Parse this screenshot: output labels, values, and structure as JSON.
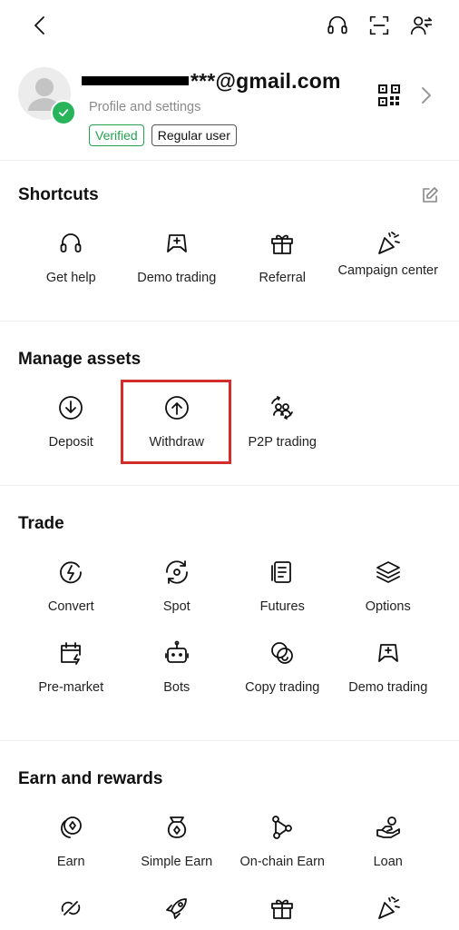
{
  "profile": {
    "email_suffix": "***@gmail.com",
    "subtitle": "Profile and settings",
    "badges": [
      "Verified",
      "Regular user"
    ]
  },
  "shortcuts": {
    "title": "Shortcuts",
    "items": [
      "Get help",
      "Demo trading",
      "Referral",
      "Campaign center"
    ]
  },
  "manage_assets": {
    "title": "Manage assets",
    "items": [
      "Deposit",
      "Withdraw",
      "P2P trading"
    ]
  },
  "trade": {
    "title": "Trade",
    "items": [
      "Convert",
      "Spot",
      "Futures",
      "Options",
      "Pre-market",
      "Bots",
      "Copy trading",
      "Demo trading"
    ]
  },
  "earn": {
    "title": "Earn and rewards",
    "items": [
      "Earn",
      "Simple Earn",
      "On-chain Earn",
      "Loan"
    ]
  },
  "colors": {
    "verified": "#27a052",
    "highlight": "#d42b2b"
  }
}
